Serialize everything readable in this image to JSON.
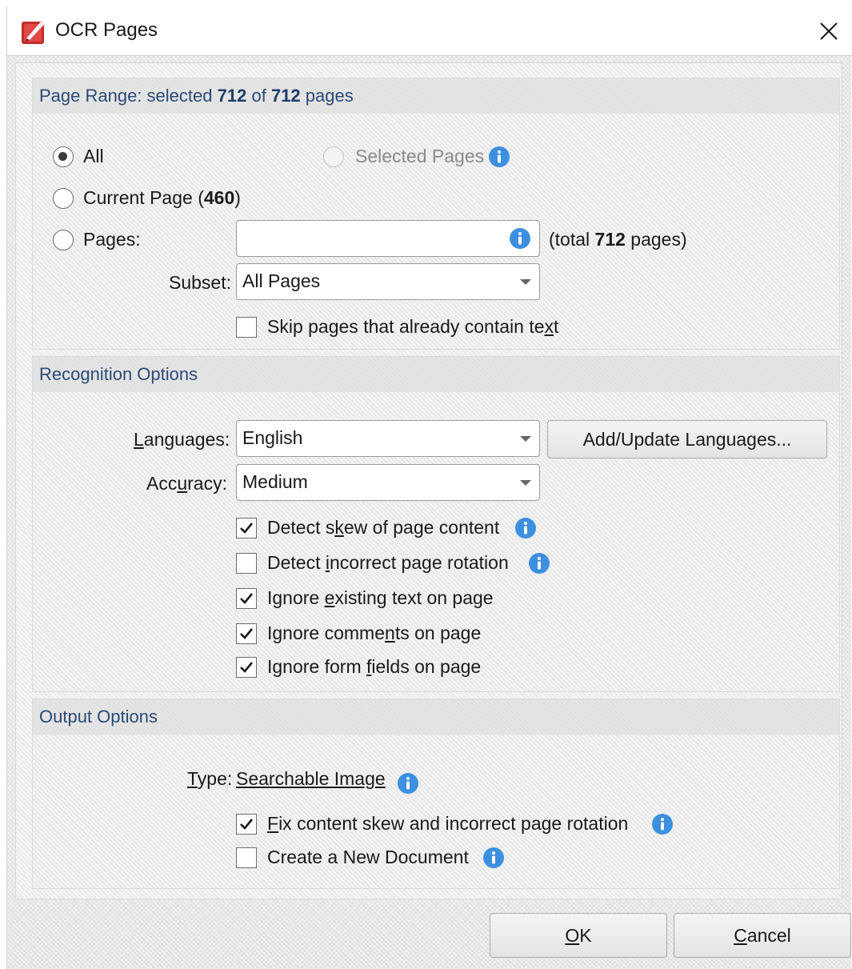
{
  "window": {
    "title": "OCR Pages"
  },
  "page_range": {
    "title_prefix": "Page Range: selected",
    "selected": "712",
    "of": "of",
    "total": "712",
    "suffix": "pages",
    "all_label": "All",
    "selected_pages_label": "Selected Pages",
    "current_page_label": "Current Page (",
    "current_page_number": "460",
    "current_page_close": ")",
    "pages_label": "Pages:",
    "pages_input_value": "",
    "total_prefix": "(total",
    "total_pages": "712",
    "total_suffix": "pages)",
    "subset_label": "Subset:",
    "subset_value": "All Pages",
    "skip_label_a": "Skip pages that already contain te",
    "skip_label_u": "x",
    "skip_label_b": "t",
    "selected_option": "All",
    "skip_checked": false
  },
  "recognition": {
    "title": "Recognition Options",
    "languages_label_u": "L",
    "languages_label_rest": "anguages:",
    "languages_value": "English",
    "add_languages_button": "Add/Update Languages...",
    "accuracy_label_a": "Acc",
    "accuracy_label_u": "u",
    "accuracy_label_b": "racy:",
    "accuracy_value": "Medium",
    "options": [
      {
        "a": "Detect s",
        "u": "k",
        "b": "ew of page content",
        "checked": true,
        "info": true
      },
      {
        "a": "Detect ",
        "u": "i",
        "b": "ncorrect page rotation",
        "checked": false,
        "info": true
      },
      {
        "a": "Ignore ",
        "u": "e",
        "b": "xisting text on page",
        "checked": true,
        "info": false
      },
      {
        "a": "Ignore comme",
        "u": "n",
        "b": "ts on page",
        "checked": true,
        "info": false
      },
      {
        "a": "Ignore form ",
        "u": "f",
        "b": "ields on page",
        "checked": true,
        "info": false
      }
    ]
  },
  "output": {
    "title": "Output Options",
    "type_label_u": "T",
    "type_label_rest": "ype:",
    "type_value": "Searchable Image",
    "fix_label_u": "F",
    "fix_label_rest": "ix content skew and incorrect page rotation",
    "fix_checked": true,
    "new_doc_label": "Create a New Document",
    "new_doc_checked": false
  },
  "buttons": {
    "ok_u": "O",
    "ok_rest": "K",
    "cancel_u": "C",
    "cancel_rest": "ancel"
  },
  "colors": {
    "info_blue": "#3d8fe0",
    "check_color": "#1a1a1a",
    "group_title": "#2a4a78",
    "app_icon_red": "#c62b2b"
  },
  "icons": {
    "app": "pdf-xchange-app-icon",
    "close": "close-icon",
    "info": "info-icon",
    "check": "checkmark-icon",
    "caret": "chevron-down-icon"
  }
}
